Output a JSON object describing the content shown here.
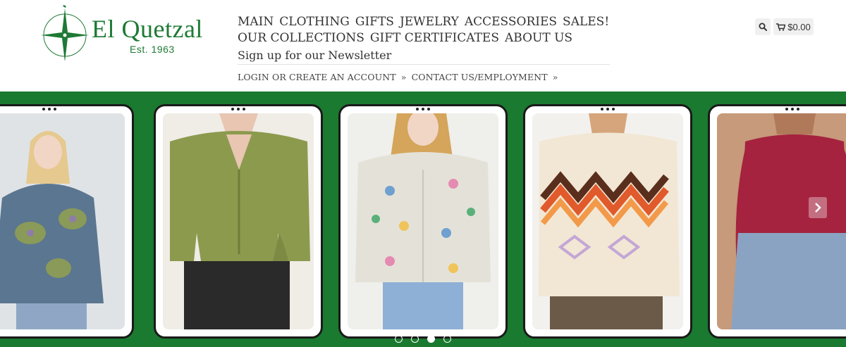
{
  "logo": {
    "name": "El Quetzal",
    "established": "Est. 1963",
    "brand_color": "#1e7a35"
  },
  "nav": {
    "row1": [
      "MAIN",
      "CLOTHING",
      "GIFTS",
      "JEWELRY",
      "ACCESSORIES",
      "SALES!"
    ],
    "row2": [
      "OUR COLLECTIONS",
      "GIFT CERTIFICATES",
      "ABOUT US"
    ],
    "newsletter": "Sign up for our Newsletter"
  },
  "account": {
    "login": "LOGIN",
    "or": "OR",
    "create": "CREATE AN ACCOUNT",
    "sep1": "»",
    "contact": "CONTACT US/EMPLOYMENT",
    "sep2": "»"
  },
  "header_tools": {
    "search_icon": "search-icon",
    "cart_icon": "cart-icon",
    "cart_total": "$0.00"
  },
  "carousel": {
    "background": "#1a7a30",
    "slides": [
      {
        "name": "slide-blue-floral-sweater",
        "colors": [
          "#dfe3e6",
          "#5b7690",
          "#8a9a58"
        ]
      },
      {
        "name": "slide-olive-cardigan",
        "colors": [
          "#f0ece6",
          "#8c9a4e",
          "#2a2a2a"
        ]
      },
      {
        "name": "slide-floral-embroidered-cardigan",
        "colors": [
          "#efefeb",
          "#e4e2d8",
          "#6fa0d0"
        ]
      },
      {
        "name": "slide-chevron-sweater",
        "colors": [
          "#f3f1ee",
          "#f1e7d4",
          "#e15a2c"
        ]
      },
      {
        "name": "slide-burgundy-top",
        "colors": [
          "#c69a7a",
          "#a5233e",
          "#8aa3c2"
        ]
      }
    ],
    "dots_count": 4,
    "active_dot": 2,
    "next_icon": "chevron-right-icon"
  }
}
